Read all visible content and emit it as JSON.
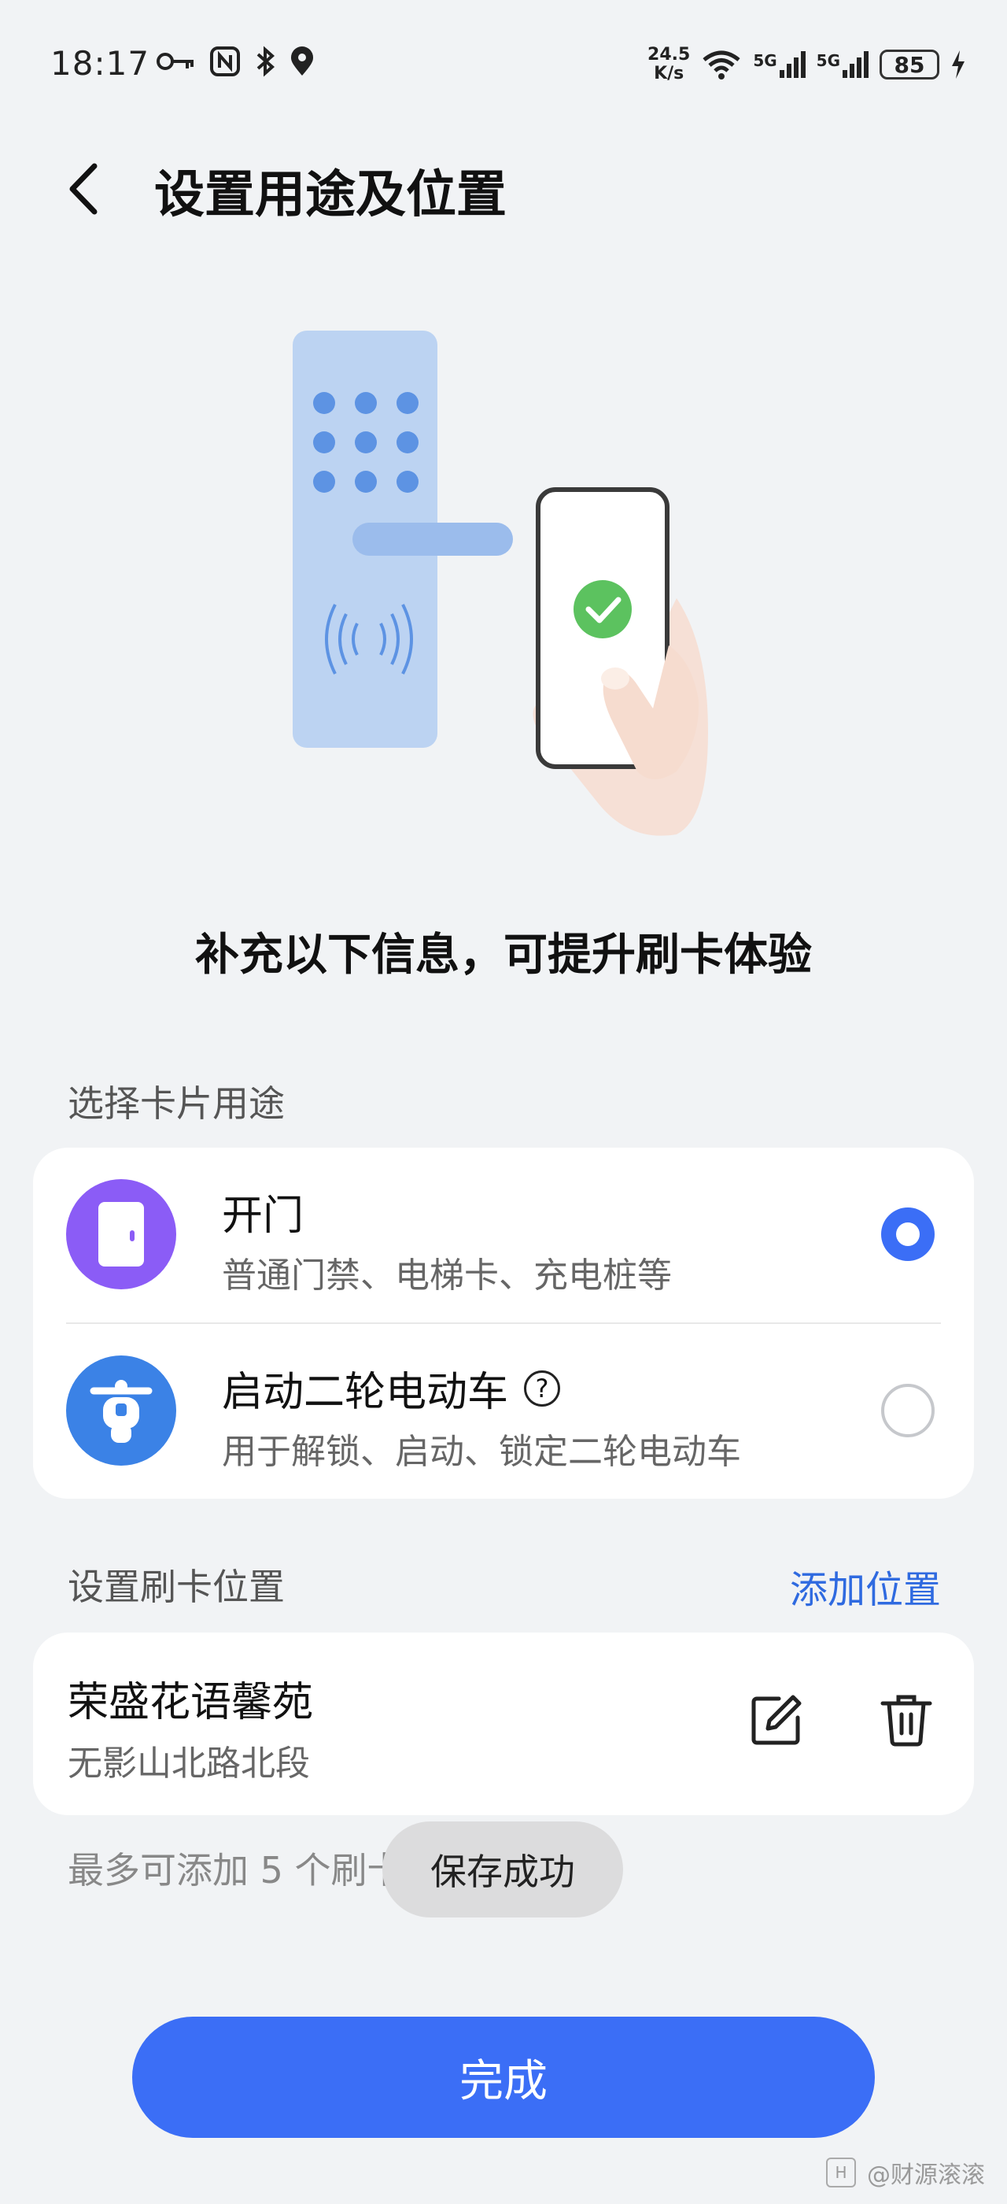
{
  "status_bar": {
    "time": "18:17",
    "net_speed_value": "24.5",
    "net_speed_unit": "K/s",
    "signal1_label": "5G",
    "signal2_label": "5G",
    "battery": "85",
    "icons_left": [
      "key-icon",
      "nfc-icon",
      "bluetooth-icon",
      "location-icon"
    ],
    "icons_right": [
      "wifi-icon",
      "signal-icon",
      "signal-icon",
      "battery-icon",
      "charging-icon"
    ]
  },
  "header": {
    "title": "设置用途及位置"
  },
  "subtitle": "补充以下信息，可提升刷卡体验",
  "usage": {
    "section_label": "选择卡片用途",
    "options": [
      {
        "title": "开门",
        "desc": "普通门禁、电梯卡、充电桩等",
        "selected": true,
        "icon": "door-icon",
        "icon_color": "#8b5cf6"
      },
      {
        "title": "启动二轮电动车",
        "desc": "用于解锁、启动、锁定二轮电动车",
        "selected": false,
        "icon": "scooter-icon",
        "icon_color": "#3b82e6",
        "help_label": "?"
      }
    ]
  },
  "location": {
    "section_label": "设置刷卡位置",
    "add_label": "添加位置",
    "items": [
      {
        "name": "荣盛花语馨苑",
        "address": "无影山北路北段"
      }
    ],
    "hint": "最多可添加 5 个刷卡位置"
  },
  "toast": "保存成功",
  "done_label": "完成",
  "watermark": "@财源滚滚",
  "colors": {
    "accent": "#3b6ef6",
    "link": "#2f6ae0",
    "background": "#f1f3f5"
  }
}
